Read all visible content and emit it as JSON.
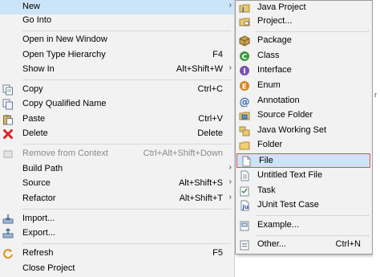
{
  "context_menu": {
    "items": [
      {
        "label": "New",
        "shortcut": "",
        "icon": "none",
        "submenu": true,
        "highlighted": true
      },
      {
        "label": "Go Into",
        "shortcut": "",
        "icon": "none"
      },
      {
        "label": "Open in New Window",
        "shortcut": "",
        "icon": "none"
      },
      {
        "label": "Open Type Hierarchy",
        "shortcut": "F4",
        "icon": "none"
      },
      {
        "label": "Show In",
        "shortcut": "Alt+Shift+W",
        "icon": "none",
        "submenu": true
      },
      {
        "label": "Copy",
        "shortcut": "Ctrl+C",
        "icon": "copy-icon"
      },
      {
        "label": "Copy Qualified Name",
        "shortcut": "",
        "icon": "copy-qualified-icon"
      },
      {
        "label": "Paste",
        "shortcut": "Ctrl+V",
        "icon": "paste-icon"
      },
      {
        "label": "Delete",
        "shortcut": "Delete",
        "icon": "delete-icon"
      },
      {
        "label": "Remove from Context",
        "shortcut": "Ctrl+Alt+Shift+Down",
        "icon": "remove-context-icon",
        "disabled": true
      },
      {
        "label": "Build Path",
        "shortcut": "",
        "icon": "none",
        "submenu": true
      },
      {
        "label": "Source",
        "shortcut": "Alt+Shift+S",
        "icon": "none",
        "submenu": true
      },
      {
        "label": "Refactor",
        "shortcut": "Alt+Shift+T",
        "icon": "none",
        "submenu": true
      },
      {
        "label": "Import...",
        "shortcut": "",
        "icon": "import-icon"
      },
      {
        "label": "Export...",
        "shortcut": "",
        "icon": "export-icon"
      },
      {
        "label": "Refresh",
        "shortcut": "F5",
        "icon": "refresh-icon"
      },
      {
        "label": "Close Project",
        "shortcut": "",
        "icon": "none"
      }
    ]
  },
  "new_submenu": {
    "items": [
      {
        "label": "Java Project",
        "shortcut": "",
        "icon": "java-project-icon"
      },
      {
        "label": "Project...",
        "shortcut": "",
        "icon": "project-icon"
      },
      {
        "label": "Package",
        "shortcut": "",
        "icon": "package-icon"
      },
      {
        "label": "Class",
        "shortcut": "",
        "icon": "class-icon"
      },
      {
        "label": "Interface",
        "shortcut": "",
        "icon": "interface-icon"
      },
      {
        "label": "Enum",
        "shortcut": "",
        "icon": "enum-icon"
      },
      {
        "label": "Annotation",
        "shortcut": "",
        "icon": "annotation-icon"
      },
      {
        "label": "Source Folder",
        "shortcut": "",
        "icon": "source-folder-icon"
      },
      {
        "label": "Java Working Set",
        "shortcut": "",
        "icon": "working-set-icon"
      },
      {
        "label": "Folder",
        "shortcut": "",
        "icon": "folder-icon"
      },
      {
        "label": "File",
        "shortcut": "",
        "icon": "file-icon",
        "selected": true
      },
      {
        "label": "Untitled Text File",
        "shortcut": "",
        "icon": "text-file-icon"
      },
      {
        "label": "Task",
        "shortcut": "",
        "icon": "task-icon"
      },
      {
        "label": "JUnit Test Case",
        "shortcut": "",
        "icon": "junit-icon"
      },
      {
        "label": "Example...",
        "shortcut": "",
        "icon": "example-icon"
      },
      {
        "label": "Other...",
        "shortcut": "Ctrl+N",
        "icon": "other-icon"
      }
    ]
  },
  "colors": {
    "menu_bg": "#f2f2f2",
    "highlight": "#cce4f7",
    "selected_border": "#d9534f",
    "disabled_text": "#8a8a8a"
  }
}
